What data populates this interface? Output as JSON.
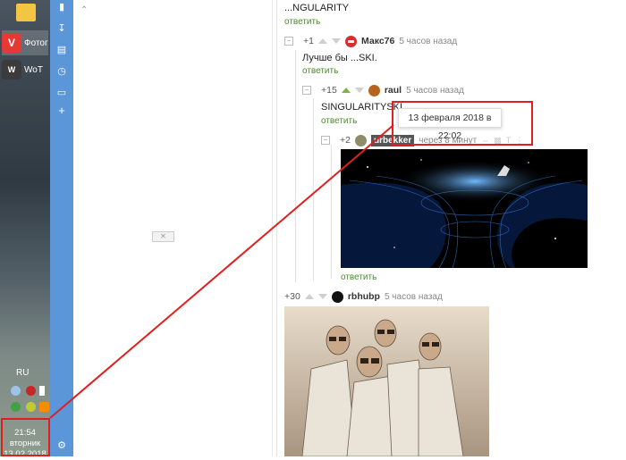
{
  "taskbar": {
    "apps": [
      {
        "label": "Фотог",
        "icon": "vivaldi-icon",
        "color": "#e53935"
      },
      {
        "label": "WoT",
        "icon": "wot-icon",
        "color": "#3b3b3b"
      }
    ],
    "lang": "RU",
    "clock": {
      "time": "21:54",
      "day": "вторник",
      "date": "13.02.2018"
    }
  },
  "panel": {
    "icons": [
      "bookmark-icon",
      "download-icon",
      "notes-icon",
      "history-icon",
      "page-icon",
      "add-icon",
      "settings-icon"
    ]
  },
  "thread": {
    "top_text": "...NGULARITY",
    "reply_label": "ответить",
    "comments": [
      {
        "rating": "+1",
        "user": "Макс76",
        "time": "5 часов назад",
        "text": "Лучше бы ...SKI.",
        "avatar_color": "#d32f2f"
      },
      {
        "rating": "+15",
        "user": "raul",
        "time": "5 часов назад",
        "text": "SINGULARITYSKI.",
        "avatar_color": "#b5651d"
      },
      {
        "rating": "+2",
        "user": "urbekker",
        "time": "через 8 минут"
      },
      {
        "rating": "+30",
        "user": "rbhubp",
        "time": "5 часов назад"
      }
    ],
    "tooltip": "13 февраля 2018 в 22:02"
  },
  "colors": {
    "accent_green": "#7cb342",
    "panel_blue": "#5a96d8",
    "highlight_red": "#e02020"
  }
}
